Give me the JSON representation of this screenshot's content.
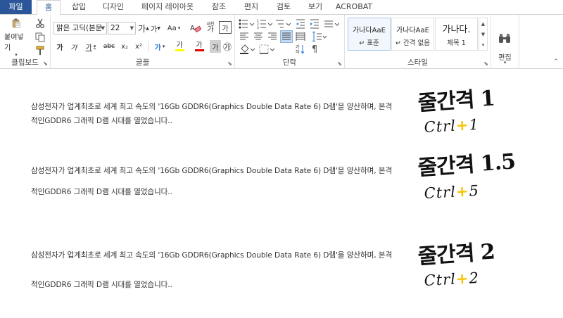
{
  "tabs": [
    {
      "label": "파일",
      "active": false
    },
    {
      "label": "홈",
      "active": true
    },
    {
      "label": "삽입",
      "active": false
    },
    {
      "label": "디자인",
      "active": false
    },
    {
      "label": "페이지 레이아웃",
      "active": false
    },
    {
      "label": "참조",
      "active": false
    },
    {
      "label": "편지",
      "active": false
    },
    {
      "label": "검토",
      "active": false
    },
    {
      "label": "보기",
      "active": false
    },
    {
      "label": "ACROBAT",
      "active": false
    }
  ],
  "ribbon": {
    "clipboard": {
      "label": "클립보드",
      "paste_label": "붙여넣기"
    },
    "font": {
      "label": "글꼴",
      "font_name": "맑은 고딕(본문",
      "font_size": "22",
      "grow_label": "가",
      "shrink_label": "가",
      "case_label": "Aa",
      "phonetic_label": "가",
      "phonetic_sub": "내천",
      "border_label": "가",
      "bold_label": "가",
      "italic_label": "가",
      "underline_label": "가",
      "strike_label": "abc",
      "subscript_label": "x₂",
      "superscript_label": "x²",
      "effects_label": "가",
      "highlight_label": "가",
      "fontcolor_label": "가",
      "shade_label": "가",
      "enclose_label": "㉮"
    },
    "paragraph": {
      "label": "단락"
    },
    "styles": {
      "label": "스타일",
      "items": [
        {
          "preview": "가나다AaE",
          "name": "↵ 표준"
        },
        {
          "preview": "가나다AaE",
          "name": "↵ 간격 없음"
        },
        {
          "preview": "가나다.",
          "name": "제목 1"
        }
      ]
    },
    "editing": {
      "label": "편집"
    }
  },
  "document": {
    "paragraphs": [
      {
        "line1": "삼성전자가 업계최초로 세계 최고 속도의 '16Gb GDDR6(Graphics Double Data Rate 6) D램'을 양산하며, 본격",
        "line2": "적인GDDR6 그래픽 D램 시대를 열었습니다.."
      },
      {
        "line1": "삼성전자가 업계최초로 세계 최고 속도의 '16Gb GDDR6(Graphics Double Data Rate 6) D램'을 양산하며, 본격",
        "line2": "적인GDDR6 그래픽 D램 시대를 열었습니다.."
      },
      {
        "line1": "삼성전자가 업계최초로 세계 최고 속도의 '16Gb GDDR6(Graphics Double Data Rate 6) D램'을 양산하며, 본격",
        "line2": "적인GDDR6 그래픽 D램 시대를 열었습니다.."
      }
    ]
  },
  "annotations": [
    {
      "title": "줄간격 1",
      "key_prefix": "Ctrl",
      "plus": "+",
      "key": "1"
    },
    {
      "title": "줄간격 1.5",
      "key_prefix": "Ctrl",
      "plus": "+",
      "key": "5"
    },
    {
      "title": "줄간격 2",
      "key_prefix": "Ctrl",
      "plus": "+",
      "key": "2"
    }
  ],
  "colors": {
    "accent": "#2b579a",
    "highlight": "#ffff00",
    "font_color": "#e00000",
    "plus_color": "#f5c400"
  }
}
